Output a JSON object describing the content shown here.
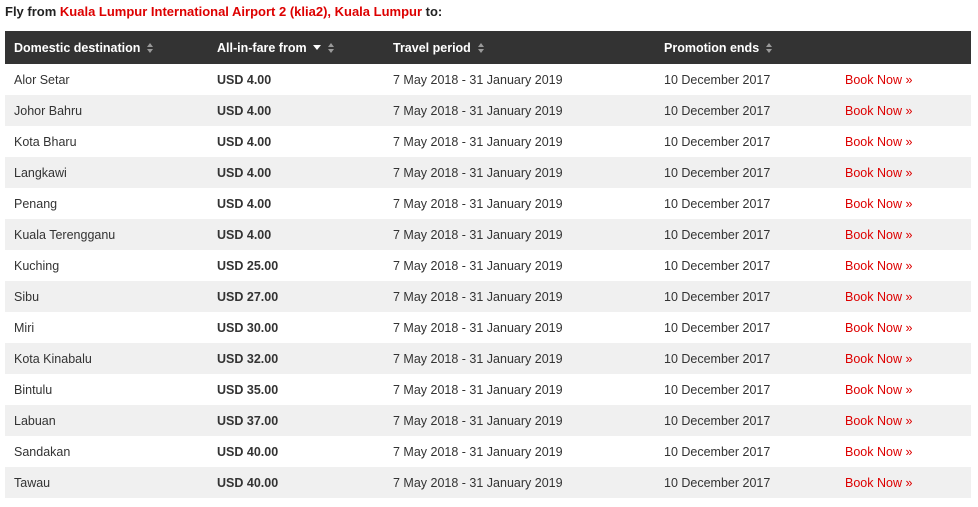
{
  "heading": {
    "prefix": "Fly from ",
    "origin_link": "Kuala Lumpur International Airport 2 (klia2), Kuala Lumpur",
    "suffix": " to:"
  },
  "columns": [
    {
      "label": "Domestic destination",
      "sort": "unsorted"
    },
    {
      "label": "All-in-fare from",
      "sort": "descending-indicator"
    },
    {
      "label": "Travel period",
      "sort": "unsorted"
    },
    {
      "label": "Promotion ends",
      "sort": "unsorted"
    },
    {
      "label": "",
      "sort": "none"
    }
  ],
  "colors": {
    "header_bg": "#333333",
    "link_red": "#dd0000",
    "row_alt": "#f0f0f0"
  },
  "rows": [
    {
      "destination": "Alor Setar",
      "fare": "USD 4.00",
      "travel": "7 May 2018 - 31 January 2019",
      "ends": "10 December 2017",
      "action": "Book Now »"
    },
    {
      "destination": "Johor Bahru",
      "fare": "USD 4.00",
      "travel": "7 May 2018 - 31 January 2019",
      "ends": "10 December 2017",
      "action": "Book Now »"
    },
    {
      "destination": "Kota Bharu",
      "fare": "USD 4.00",
      "travel": "7 May 2018 - 31 January 2019",
      "ends": "10 December 2017",
      "action": "Book Now »"
    },
    {
      "destination": "Langkawi",
      "fare": "USD 4.00",
      "travel": "7 May 2018 - 31 January 2019",
      "ends": "10 December 2017",
      "action": "Book Now »"
    },
    {
      "destination": "Penang",
      "fare": "USD 4.00",
      "travel": "7 May 2018 - 31 January 2019",
      "ends": "10 December 2017",
      "action": "Book Now »"
    },
    {
      "destination": "Kuala Terengganu",
      "fare": "USD 4.00",
      "travel": "7 May 2018 - 31 January 2019",
      "ends": "10 December 2017",
      "action": "Book Now »"
    },
    {
      "destination": "Kuching",
      "fare": "USD 25.00",
      "travel": "7 May 2018 - 31 January 2019",
      "ends": "10 December 2017",
      "action": "Book Now »"
    },
    {
      "destination": "Sibu",
      "fare": "USD 27.00",
      "travel": "7 May 2018 - 31 January 2019",
      "ends": "10 December 2017",
      "action": "Book Now »"
    },
    {
      "destination": "Miri",
      "fare": "USD 30.00",
      "travel": "7 May 2018 - 31 January 2019",
      "ends": "10 December 2017",
      "action": "Book Now »"
    },
    {
      "destination": "Kota Kinabalu",
      "fare": "USD 32.00",
      "travel": "7 May 2018 - 31 January 2019",
      "ends": "10 December 2017",
      "action": "Book Now »"
    },
    {
      "destination": "Bintulu",
      "fare": "USD 35.00",
      "travel": "7 May 2018 - 31 January 2019",
      "ends": "10 December 2017",
      "action": "Book Now »"
    },
    {
      "destination": "Labuan",
      "fare": "USD 37.00",
      "travel": "7 May 2018 - 31 January 2019",
      "ends": "10 December 2017",
      "action": "Book Now »"
    },
    {
      "destination": "Sandakan",
      "fare": "USD 40.00",
      "travel": "7 May 2018 - 31 January 2019",
      "ends": "10 December 2017",
      "action": "Book Now »"
    },
    {
      "destination": "Tawau",
      "fare": "USD 40.00",
      "travel": "7 May 2018 - 31 January 2019",
      "ends": "10 December 2017",
      "action": "Book Now »"
    }
  ]
}
